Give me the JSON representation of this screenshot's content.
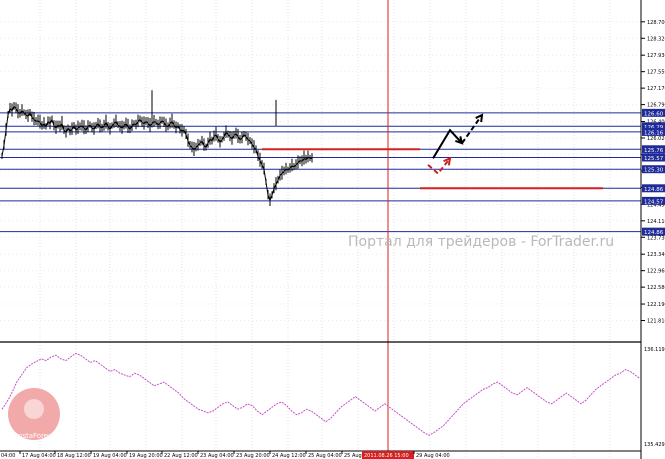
{
  "chart_data": [
    {
      "type": "line",
      "title": "",
      "price_axis": {
        "ylim": [
          121.43,
          128.88
        ],
        "ticks": [
          "128.700",
          "128.320",
          "127.930",
          "127.550",
          "127.170",
          "126.790",
          "126.400",
          "126.020",
          "125.640",
          "125.260",
          "124.880",
          "124.490",
          "124.110",
          "123.730",
          "123.340",
          "122.960",
          "122.580",
          "122.190",
          "121.810"
        ]
      },
      "time_axis": {
        "labels": [
          "17 Aug 04:00",
          "18 Aug 12:00",
          "19 Aug 04:00",
          "19 Aug 20:00",
          "22 Aug 12:00",
          "23 Aug 04:00",
          "23 Aug 20:00",
          "24 Aug 12:00",
          "25 Aug 04:00",
          "25 Aug 20:00",
          "2011.08.26 15:00",
          "29 Aug 04:00"
        ],
        "highlight_label": "2011.08.26 15:00",
        "partial_left_label": "04:00"
      },
      "level_labels": [
        "126.60",
        "126.29",
        "126.16",
        "125.76",
        "125.57",
        "125.30",
        "124.86",
        "124.57",
        "124.86"
      ],
      "price_series": {
        "x": [
          0,
          2,
          4,
          6,
          8,
          10,
          12,
          14,
          16,
          18,
          20,
          22,
          24,
          26,
          28,
          30,
          32,
          34,
          36,
          38,
          40,
          42,
          44,
          46,
          48,
          50,
          52,
          54,
          56,
          58,
          60,
          62,
          64,
          66,
          68,
          70,
          72,
          74,
          76,
          78,
          80,
          82,
          84,
          86,
          88,
          90,
          92,
          94,
          96,
          98,
          100,
          102,
          104,
          106,
          108,
          110,
          112,
          114,
          116,
          118,
          120,
          122,
          124,
          126,
          128,
          130,
          132,
          134,
          136,
          138,
          140,
          142,
          144,
          146,
          148,
          150,
          152,
          154,
          156,
          158,
          160,
          162,
          164,
          166,
          168,
          170,
          172,
          174,
          176,
          178,
          180,
          182,
          184,
          186,
          188,
          190,
          192,
          194,
          196,
          198,
          200,
          202,
          204,
          206,
          208,
          210,
          212,
          214,
          216,
          218,
          220,
          222,
          224,
          226,
          228,
          230,
          232,
          234,
          236,
          238,
          240,
          242,
          244,
          246,
          248,
          250,
          252,
          254,
          256,
          258,
          260,
          262,
          264,
          266,
          268,
          270,
          272,
          274,
          276,
          278,
          280,
          282,
          284,
          286,
          288,
          290,
          292,
          294,
          296,
          298,
          300,
          302,
          304,
          306,
          308,
          310,
          312,
          314,
          316,
          318,
          320,
          322,
          324,
          326,
          328,
          330,
          332,
          334,
          336,
          338,
          340,
          342,
          344,
          346,
          348,
          350,
          352,
          354,
          356,
          358,
          360,
          362,
          364,
          366,
          368,
          370,
          372,
          374,
          376,
          378,
          380,
          382,
          384,
          386,
          388,
          390,
          392,
          394,
          396,
          398,
          400,
          402,
          404,
          406,
          408,
          410,
          412,
          414,
          416,
          418,
          420,
          422,
          424,
          426,
          428,
          430,
          432,
          434,
          436,
          438
        ],
        "y": [
          125.6,
          125.85,
          126.2,
          126.55,
          126.7,
          126.65,
          126.75,
          126.7,
          126.62,
          126.58,
          126.65,
          126.6,
          126.55,
          126.52,
          126.6,
          126.5,
          126.45,
          126.4,
          126.42,
          126.38,
          126.3,
          126.35,
          126.28,
          126.4,
          126.35,
          126.45,
          126.3,
          126.25,
          126.32,
          126.28,
          126.35,
          126.2,
          126.15,
          126.25,
          126.18,
          126.22,
          126.3,
          126.2,
          126.25,
          126.28,
          126.3,
          126.25,
          126.2,
          126.28,
          126.32,
          126.25,
          126.22,
          126.3,
          126.35,
          126.28,
          126.25,
          126.3,
          126.38,
          126.28,
          126.22,
          126.3,
          126.35,
          126.4,
          126.32,
          126.28,
          126.25,
          126.3,
          126.35,
          126.28,
          126.22,
          126.3,
          126.35,
          126.32,
          126.4,
          126.45,
          126.38,
          126.35,
          126.4,
          126.36,
          126.3,
          126.35,
          126.4,
          126.38,
          126.32,
          126.36,
          126.42,
          126.38,
          126.3,
          126.28,
          126.35,
          126.4,
          126.32,
          126.25,
          126.3,
          126.22,
          126.18,
          126.2,
          126.1,
          125.95,
          125.85,
          125.8,
          125.75,
          125.8,
          125.85,
          125.9,
          125.95,
          125.85,
          125.8,
          125.9,
          126.0,
          125.95,
          126.05,
          126.1,
          126.0,
          125.92,
          125.98,
          126.05,
          126.15,
          126.1,
          126.05,
          126.0,
          126.08,
          126.12,
          126.05,
          125.98,
          126.02,
          126.1,
          126.05,
          125.98,
          125.95,
          125.88,
          125.8,
          125.75,
          125.6,
          125.5,
          125.4,
          125.3,
          125.0,
          124.7,
          124.58,
          124.7,
          124.85,
          124.95,
          125.05,
          125.15,
          125.2,
          125.25,
          125.3,
          125.28,
          125.32,
          125.38,
          125.35,
          125.4,
          125.45,
          125.5,
          125.48,
          125.55,
          125.52,
          125.58,
          125.55,
          125.55
        ],
        "color": "#000000"
      },
      "levels": [
        {
          "price": 126.6,
          "color": "#1f2b9a"
        },
        {
          "price": 126.29,
          "color": "#1f2b9a"
        },
        {
          "price": 126.16,
          "color": "#1f2b9a"
        },
        {
          "price": 125.76,
          "color": "#1f2b9a"
        },
        {
          "price": 125.57,
          "color": "#1f2b9a"
        },
        {
          "price": 125.3,
          "color": "#1f2b9a"
        },
        {
          "price": 124.86,
          "color": "#1f2b9a"
        },
        {
          "price": 124.57,
          "color": "#1f2b9a"
        },
        {
          "price": 123.86,
          "color": "#1f2b9a"
        }
      ],
      "resistance_lines": [
        {
          "price": 125.76,
          "color": "#d42020"
        },
        {
          "price": 124.86,
          "color": "#d42020"
        }
      ],
      "projections": [
        {
          "style": "solid",
          "color": "#000000",
          "points": [
            [
              433,
              125.55
            ],
            [
              450,
              126.2
            ],
            [
              462,
              125.9
            ]
          ]
        },
        {
          "style": "dashed",
          "color": "#000000",
          "points": [
            [
              462,
              125.9
            ],
            [
              482,
              126.55
            ]
          ]
        },
        {
          "style": "dashed",
          "color": "#cc1f1f",
          "points": [
            [
              428,
              125.4
            ],
            [
              438,
              125.2
            ],
            [
              450,
              125.55
            ]
          ]
        }
      ],
      "vertical_marker": {
        "label": "2011.08.26 15:00",
        "color": "#d42020"
      },
      "watermark": "Портал для трейдеров - ForTrader.ru"
    },
    {
      "type": "line",
      "title": "",
      "indicator_axis": {
        "top_label": "136.119",
        "bottom_label": "135.429"
      },
      "series": [
        {
          "color": "#c94fc9",
          "values": [
            0.32,
            0.4,
            0.5,
            0.62,
            0.7,
            0.78,
            0.82,
            0.85,
            0.88,
            0.86,
            0.9,
            0.92,
            0.88,
            0.86,
            0.9,
            0.94,
            0.92,
            0.88,
            0.84,
            0.86,
            0.82,
            0.78,
            0.74,
            0.76,
            0.72,
            0.7,
            0.68,
            0.72,
            0.7,
            0.66,
            0.62,
            0.58,
            0.6,
            0.62,
            0.58,
            0.54,
            0.5,
            0.44,
            0.4,
            0.36,
            0.32,
            0.3,
            0.28,
            0.3,
            0.34,
            0.38,
            0.4,
            0.36,
            0.32,
            0.34,
            0.38,
            0.36,
            0.3,
            0.26,
            0.3,
            0.34,
            0.38,
            0.4,
            0.36,
            0.3,
            0.26,
            0.28,
            0.32,
            0.3,
            0.26,
            0.22,
            0.18,
            0.22,
            0.28,
            0.34,
            0.38,
            0.42,
            0.46,
            0.42,
            0.38,
            0.34,
            0.3,
            0.34,
            0.38,
            0.34,
            0.3,
            0.26,
            0.22,
            0.18,
            0.14,
            0.1,
            0.06,
            0.03,
            0.06,
            0.1,
            0.14,
            0.2,
            0.26,
            0.32,
            0.38,
            0.42,
            0.46,
            0.5,
            0.54,
            0.56,
            0.6,
            0.62,
            0.58,
            0.54,
            0.5,
            0.48,
            0.52,
            0.56,
            0.52,
            0.48,
            0.44,
            0.4,
            0.38,
            0.42,
            0.46,
            0.5,
            0.46,
            0.42,
            0.38,
            0.42,
            0.48,
            0.54,
            0.58,
            0.62,
            0.66,
            0.7,
            0.72,
            0.76,
            0.74,
            0.7,
            0.66
          ]
        }
      ]
    }
  ]
}
